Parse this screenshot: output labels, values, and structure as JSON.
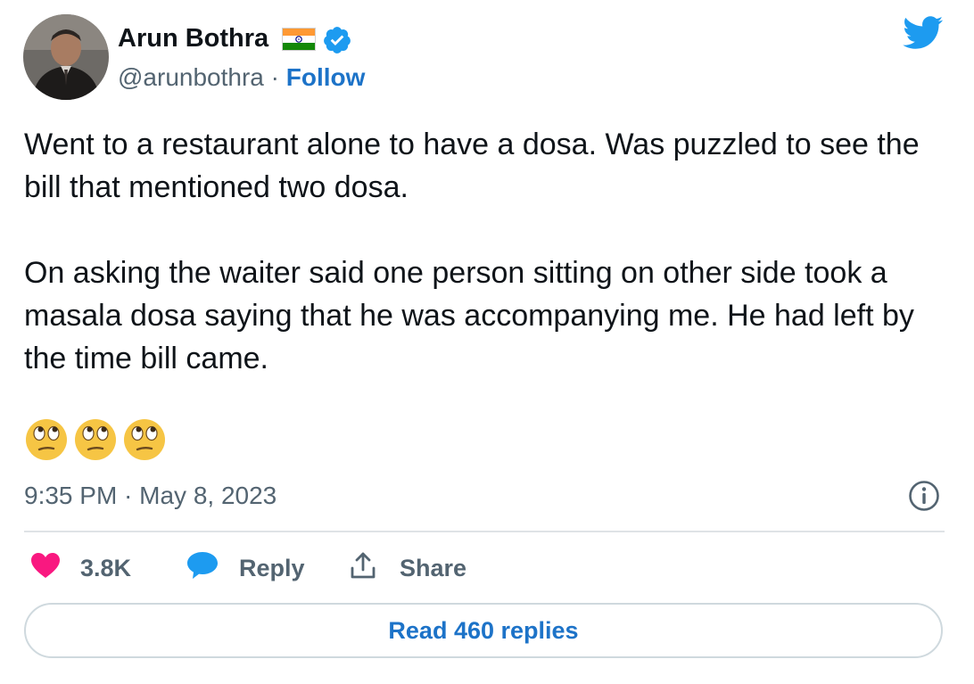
{
  "author": {
    "name": "Arun Bothra",
    "handle": "@arunbothra",
    "separator": "·",
    "follow_label": "Follow",
    "flag_icon": "india-flag-icon",
    "verified_icon": "verified-badge-icon"
  },
  "tweet": {
    "text": "Went to a restaurant alone to have a dosa. Was puzzled to see the bill that mentioned two dosa.\n\nOn asking the waiter said one person sitting on other side took a masala dosa saying that he was accompanying me. He had left by the time bill came.",
    "emojis": [
      "face-with-rolling-eyes",
      "face-with-rolling-eyes",
      "face-with-rolling-eyes"
    ],
    "timestamp": "9:35 PM · May 8, 2023"
  },
  "actions": {
    "like_count": "3.8K",
    "reply_label": "Reply",
    "share_label": "Share"
  },
  "footer": {
    "read_replies_label": "Read 460 replies"
  },
  "colors": {
    "accent": "#1d73c8",
    "like": "#f91880",
    "twitter_blue": "#1d9bf0",
    "secondary_text": "#536471"
  }
}
